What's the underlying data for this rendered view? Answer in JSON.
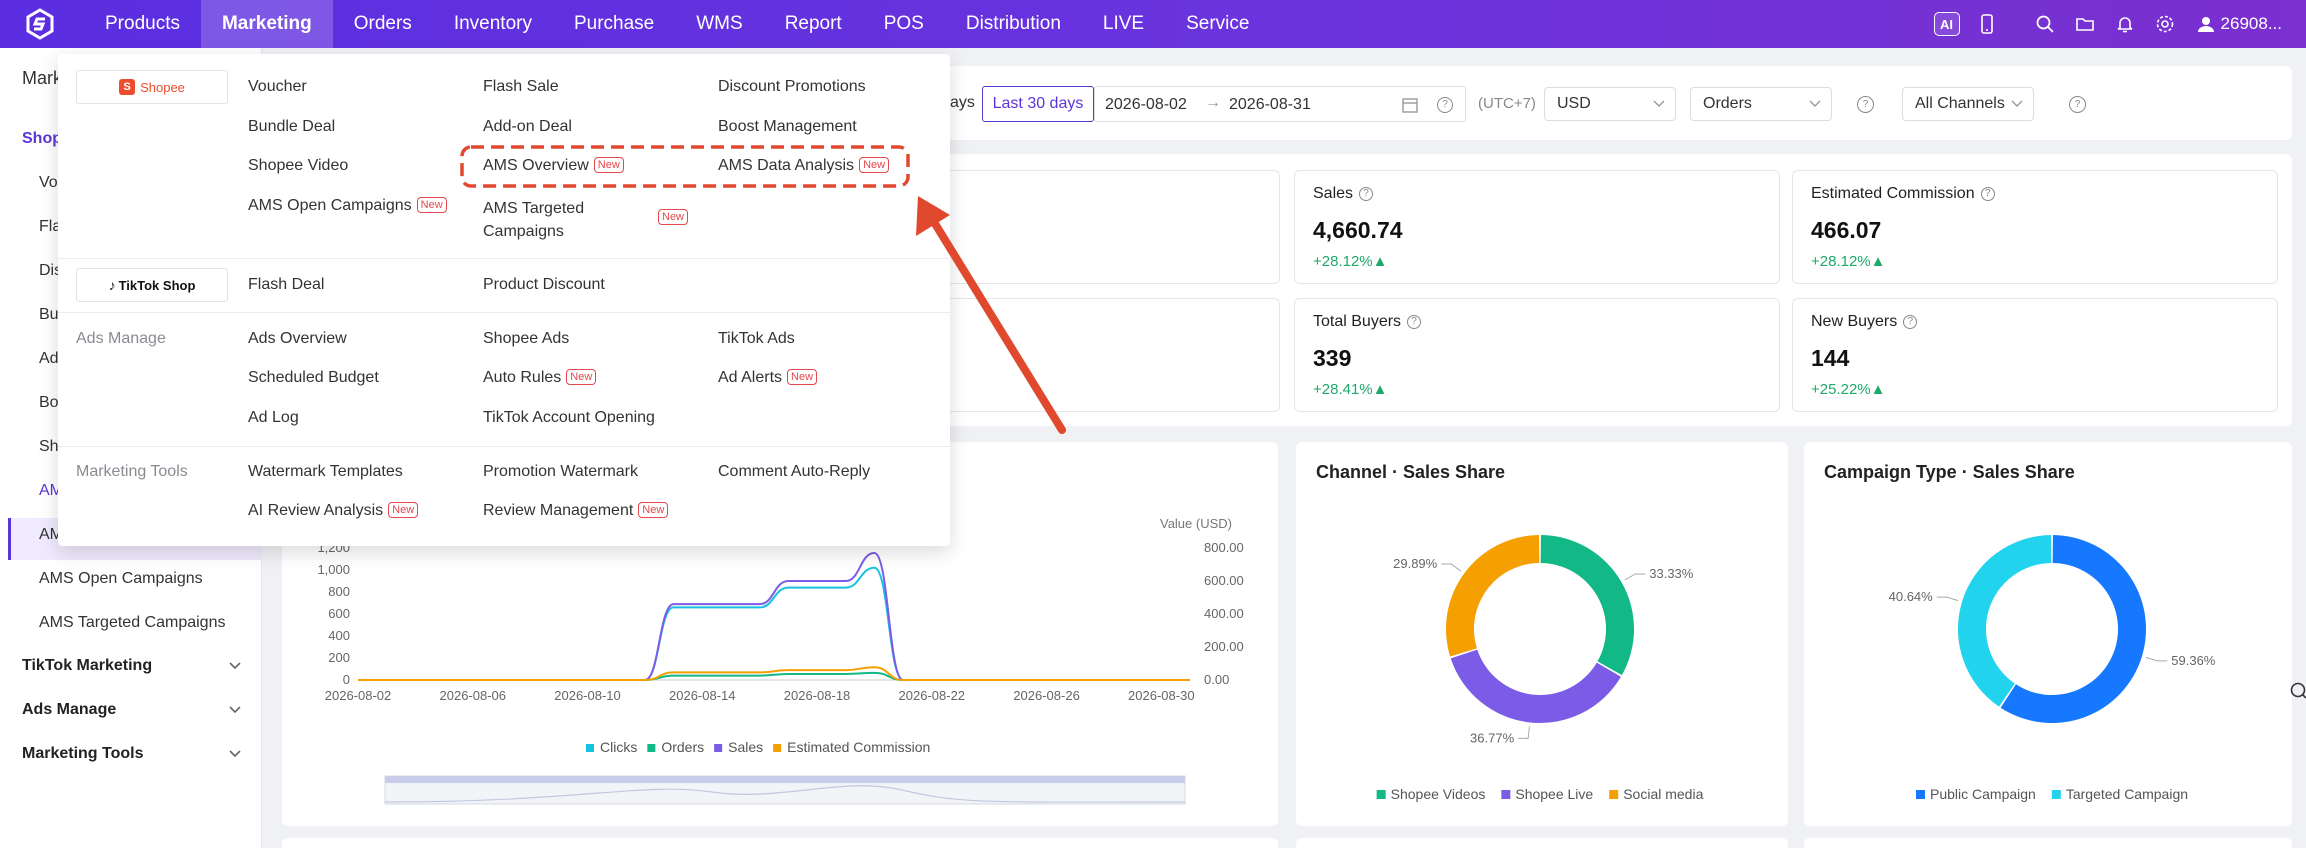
{
  "topbar": {
    "nav": [
      "Products",
      "Marketing",
      "Orders",
      "Inventory",
      "Purchase",
      "WMS",
      "Report",
      "POS",
      "Distribution",
      "LIVE",
      "Service"
    ],
    "active_nav": "Marketing",
    "ai_label": "AI",
    "user": "26908..."
  },
  "sidebar": {
    "title": "Mark",
    "group_shopee": "Shop",
    "items": [
      "Vo",
      "Fla",
      "Dis",
      "Bu",
      "Ad",
      "Bo",
      "Sh",
      "AM",
      "AM",
      "AMS Open Campaigns",
      "AMS Targeted Campaigns"
    ],
    "groups": [
      "TikTok Marketing",
      "Ads Manage",
      "Marketing Tools"
    ]
  },
  "filters": {
    "days_partial": "ays",
    "last30": "Last 30 days",
    "start": "2026-08-02",
    "end": "2026-08-31",
    "tz": "(UTC+7)",
    "currency": "USD",
    "metric": "Orders",
    "channel": "All Channels"
  },
  "cards": [
    {
      "label": "Sales",
      "value": "4,660.74",
      "delta": "+28.12%▲"
    },
    {
      "label": "Estimated Commission",
      "value": "466.07",
      "delta": "+28.12%▲"
    },
    {
      "label": "Total Buyers",
      "value": "339",
      "delta": "+28.41%▲"
    },
    {
      "label": "New Buyers",
      "value": "144",
      "delta": "+25.22%▲"
    }
  ],
  "mega": {
    "shopee_label": "Shopee",
    "tiktok_label": "TikTok Shop",
    "new_tag": "New",
    "shopee_col1": [
      "Voucher",
      "Bundle Deal",
      "Shopee Video",
      "AMS Open Campaigns"
    ],
    "shopee_col2": [
      "Flash Sale",
      "Add-on Deal",
      "AMS Overview",
      "AMS Targeted Campaigns"
    ],
    "shopee_col3": [
      "Discount Promotions",
      "Boost Management",
      "AMS Data Analysis"
    ],
    "tiktok_items": [
      "Flash Deal",
      "Product Discount"
    ],
    "ads_label": "Ads Manage",
    "ads_col1": [
      "Ads Overview",
      "Scheduled Budget",
      "Ad Log"
    ],
    "ads_col2": [
      "Shopee Ads",
      "Auto Rules",
      "TikTok Account Opening"
    ],
    "ads_col3": [
      "TikTok Ads",
      "Ad Alerts"
    ],
    "tools_label": "Marketing Tools",
    "tools_col1": [
      "Watermark Templates",
      "AI Review Analysis"
    ],
    "tools_col2": [
      "Promotion Watermark",
      "Review Management"
    ],
    "tools_col3": [
      "Comment Auto-Reply"
    ]
  },
  "colors": {
    "accent": "#5b35d6",
    "clicks": "#17c2e0",
    "orders": "#12b886",
    "sales": "#7c5ce6",
    "commission": "#f59f00",
    "annotation": "#e0492d"
  },
  "chart_data": [
    {
      "type": "line",
      "title": "",
      "x": [
        "2026-08-02",
        "2026-08-03",
        "2026-08-04",
        "2026-08-05",
        "2026-08-06",
        "2026-08-07",
        "2026-08-08",
        "2026-08-09",
        "2026-08-10",
        "2026-08-11",
        "2026-08-12",
        "2026-08-13",
        "2026-08-14",
        "2026-08-15",
        "2026-08-16",
        "2026-08-17",
        "2026-08-18",
        "2026-08-19",
        "2026-08-20",
        "2026-08-21",
        "2026-08-22",
        "2026-08-23",
        "2026-08-24",
        "2026-08-25",
        "2026-08-26",
        "2026-08-27",
        "2026-08-28",
        "2026-08-29",
        "2026-08-30",
        "2026-08-31"
      ],
      "x_ticks": [
        "2026-08-02",
        "2026-08-06",
        "2026-08-10",
        "2026-08-14",
        "2026-08-18",
        "2026-08-22",
        "2026-08-26",
        "2026-08-30"
      ],
      "y_left_ticks": [
        "0",
        "200",
        "400",
        "600",
        "800",
        "1,000",
        "1,200"
      ],
      "y_right_ticks": [
        "0.00",
        "200.00",
        "400.00",
        "600.00",
        "800.00"
      ],
      "ylabel_right": "Value (USD)",
      "ylim_left": [
        0,
        1200
      ],
      "ylim_right": [
        0,
        800
      ],
      "series": [
        {
          "name": "Clicks",
          "axis": "left",
          "values": [
            0,
            0,
            0,
            0,
            0,
            0,
            0,
            0,
            0,
            0,
            0,
            660,
            660,
            660,
            660,
            840,
            840,
            840,
            1020,
            0,
            0,
            0,
            0,
            0,
            0,
            0,
            0,
            0,
            0,
            0
          ]
        },
        {
          "name": "Orders",
          "axis": "left",
          "values": [
            0,
            0,
            0,
            0,
            0,
            0,
            0,
            0,
            0,
            0,
            0,
            40,
            40,
            40,
            40,
            55,
            55,
            55,
            65,
            0,
            0,
            0,
            0,
            0,
            0,
            0,
            0,
            0,
            0,
            0
          ]
        },
        {
          "name": "Sales",
          "axis": "right",
          "values": [
            0,
            0,
            0,
            0,
            0,
            0,
            0,
            0,
            0,
            0,
            0,
            460,
            460,
            460,
            460,
            600,
            600,
            600,
            770,
            0,
            0,
            0,
            0,
            0,
            0,
            0,
            0,
            0,
            0,
            0
          ]
        },
        {
          "name": "Estimated Commission",
          "axis": "right",
          "values": [
            0,
            0,
            0,
            0,
            0,
            0,
            0,
            0,
            0,
            0,
            0,
            46,
            46,
            46,
            46,
            60,
            60,
            60,
            77,
            0,
            0,
            0,
            0,
            0,
            0,
            0,
            0,
            0,
            0,
            0
          ]
        }
      ]
    },
    {
      "type": "pie",
      "title": "Channel · Sales Share",
      "categories": [
        "Shopee Videos",
        "Shopee Live",
        "Social media"
      ],
      "values": [
        33.33,
        36.77,
        29.89
      ],
      "labels": [
        "33.33%",
        "36.77%",
        "29.89%"
      ]
    },
    {
      "type": "pie",
      "title": "Campaign Type · Sales Share",
      "categories": [
        "Public Campaign",
        "Targeted Campaign"
      ],
      "values": [
        59.36,
        40.64
      ],
      "labels": [
        "59.36%",
        "40.64%"
      ]
    }
  ]
}
